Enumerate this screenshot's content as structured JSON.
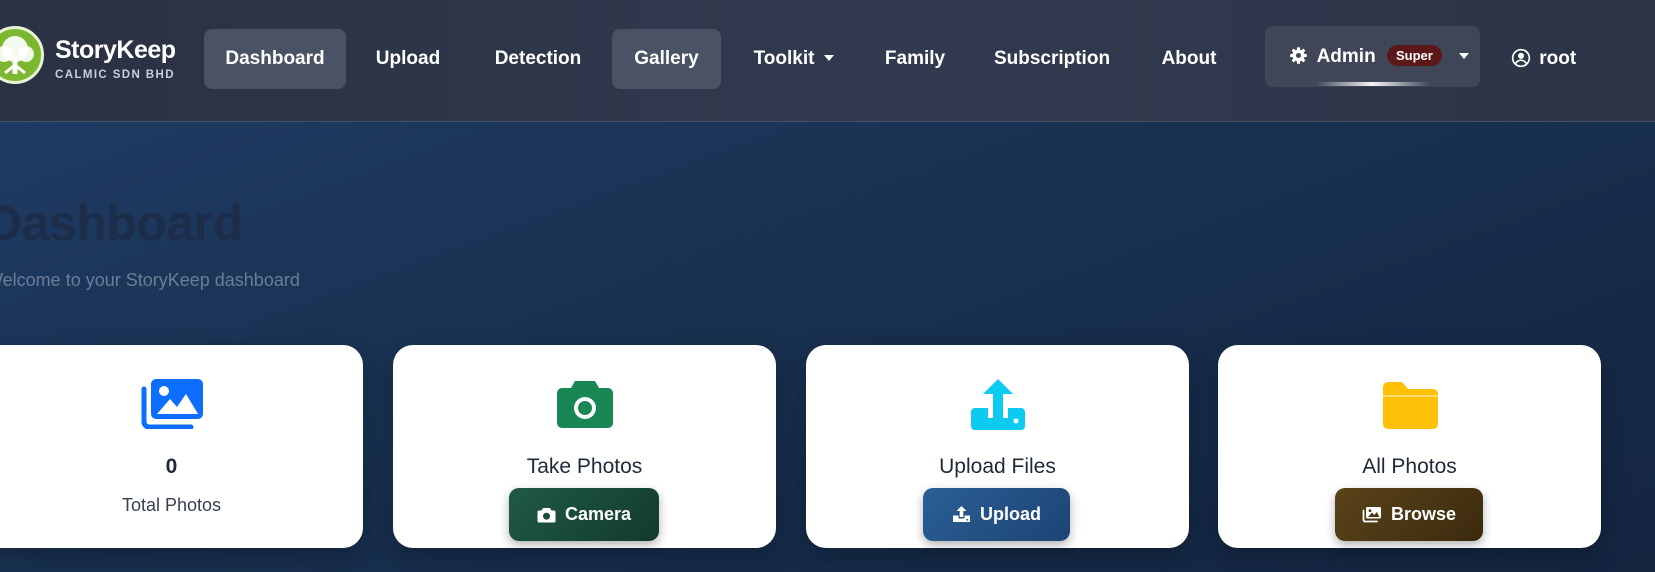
{
  "brand": {
    "name": "StoryKeep",
    "company": "CALMIC SDN BHD"
  },
  "nav": {
    "items": [
      {
        "label": "Dashboard"
      },
      {
        "label": "Upload"
      },
      {
        "label": "Detection"
      },
      {
        "label": "Gallery"
      },
      {
        "label": "Toolkit"
      },
      {
        "label": "Family"
      },
      {
        "label": "Subscription"
      },
      {
        "label": "About"
      }
    ],
    "active": [
      "Dashboard",
      "Gallery"
    ],
    "admin": {
      "label": "Admin",
      "badge": "Super"
    },
    "user": {
      "label": "root",
      "icon": "user-circle-icon"
    }
  },
  "page": {
    "title": "Dashboard",
    "subtitle": "Welcome to your StoryKeep dashboard"
  },
  "cards": {
    "stats": {
      "value": "0",
      "label": "Total Photos",
      "icon": "images-icon",
      "color": "#0d6efd"
    },
    "take_photos": {
      "title": "Take Photos",
      "button": "Camera",
      "icon": "camera-icon",
      "color": "#198754",
      "button_color": "#1b4d3e"
    },
    "upload_files": {
      "title": "Upload Files",
      "button": "Upload",
      "icon": "upload-icon",
      "color": "#0dcaf0",
      "button_color": "#1e4f82"
    },
    "all_photos": {
      "title": "All Photos",
      "button": "Browse",
      "icon": "folder-icon",
      "color": "#ffc107",
      "button_color": "#4a3613"
    }
  },
  "colors": {
    "navbar": "#2d3448",
    "background": "#1a2c4b",
    "badge": "#5c1818"
  }
}
